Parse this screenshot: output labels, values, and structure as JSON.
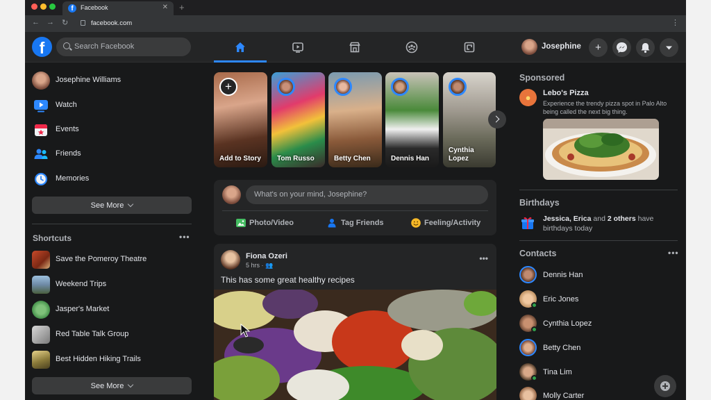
{
  "browser": {
    "tab_title": "Facebook",
    "url": "facebook.com"
  },
  "topbar": {
    "logo": "f",
    "search_placeholder": "Search Facebook",
    "tabs": [
      "home-icon",
      "watch-icon",
      "marketplace-icon",
      "groups-icon",
      "gaming-icon"
    ],
    "user_name": "Josephine"
  },
  "left": {
    "items": [
      {
        "label": "Josephine Williams",
        "icon": "avatar"
      },
      {
        "label": "Watch",
        "icon": "watch-icon"
      },
      {
        "label": "Events",
        "icon": "calendar-icon"
      },
      {
        "label": "Friends",
        "icon": "friends-icon"
      },
      {
        "label": "Memories",
        "icon": "clock-icon"
      }
    ],
    "see_more": "See More",
    "shortcuts_title": "Shortcuts",
    "shortcuts": [
      {
        "label": "Save the Pomeroy Theatre"
      },
      {
        "label": "Weekend Trips"
      },
      {
        "label": "Jasper's Market"
      },
      {
        "label": "Red Table Talk Group"
      },
      {
        "label": "Best Hidden Hiking Trails"
      }
    ],
    "see_more_2": "See More"
  },
  "stories": [
    {
      "name": "Add to Story"
    },
    {
      "name": "Tom Russo"
    },
    {
      "name": "Betty Chen"
    },
    {
      "name": "Dennis Han"
    },
    {
      "name": "Cynthia Lopez"
    }
  ],
  "composer": {
    "placeholder": "What's on your mind, Josephine?",
    "actions": [
      "Photo/Video",
      "Tag Friends",
      "Feeling/Activity"
    ]
  },
  "post": {
    "author": "Fiona Ozeri",
    "time": "5 hrs",
    "text": "This has some great healthy recipes"
  },
  "right": {
    "sponsored_title": "Sponsored",
    "ad_name": "Lebo's Pizza",
    "ad_desc": "Experience the trendy pizza spot in Palo Alto being called the next big thing.",
    "birthdays_title": "Birthdays",
    "bday_names": "Jessica, Erica",
    "bday_and": " and ",
    "bday_others": "2 others",
    "bday_rest": " have birthdays today",
    "contacts_title": "Contacts",
    "contacts": [
      {
        "name": "Dennis Han"
      },
      {
        "name": "Eric Jones"
      },
      {
        "name": "Cynthia Lopez"
      },
      {
        "name": "Betty Chen"
      },
      {
        "name": "Tina Lim"
      },
      {
        "name": "Molly Carter"
      }
    ]
  }
}
